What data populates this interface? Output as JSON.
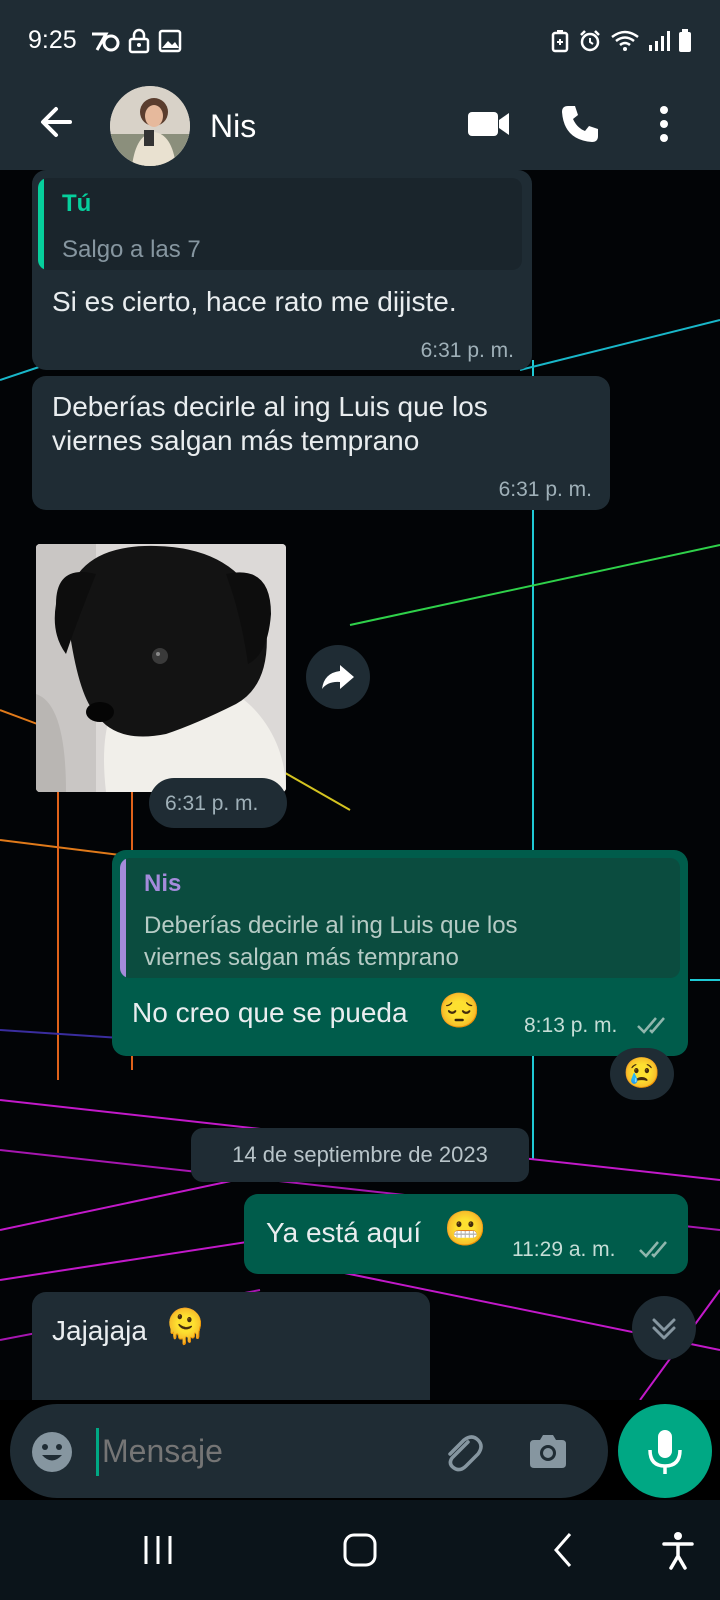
{
  "status_bar": {
    "time": "9:25",
    "left_icons": [
      "notification-icon",
      "lock-icon",
      "image-icon"
    ],
    "right_icons": [
      "battery-saver-icon",
      "alarm-icon",
      "wifi-icon",
      "signal-icon",
      "battery-icon"
    ]
  },
  "header": {
    "contact_name": "Nis",
    "back_icon": "arrow-left-icon",
    "video_icon": "video-camera-icon",
    "call_icon": "phone-icon",
    "menu_icon": "more-vert-icon"
  },
  "messages": [
    {
      "type": "incoming",
      "quote_author": "Tú",
      "quote_text": "Salgo a las 7",
      "text": "Si es cierto, hace rato me dijiste.",
      "time": "6:31 p. m."
    },
    {
      "type": "incoming",
      "text_line1": "Deberías decirle al ing Luis que los",
      "text_line2": "viernes salgan más temprano",
      "time": "6:31 p. m."
    },
    {
      "type": "incoming_image",
      "time": "6:31 p. m.",
      "forward_icon": "forward-icon"
    },
    {
      "type": "outgoing",
      "quote_author": "Nis",
      "quote_line1": "Deberías decirle al ing Luis que los",
      "quote_line2": "viernes salgan más temprano",
      "text": "No creo que se pueda",
      "emoji": "😔",
      "time": "8:13 p. m.",
      "reaction": "😢"
    },
    {
      "type": "date",
      "text": "14 de septiembre de 2023"
    },
    {
      "type": "outgoing",
      "text": "Ya está aquí",
      "emoji": "😬",
      "time": "11:29 a. m."
    },
    {
      "type": "incoming",
      "text": "Jajajaja",
      "emoji": "🫠"
    }
  ],
  "scroll_down_icon": "double-chevron-down-icon",
  "composer": {
    "placeholder": "Mensaje",
    "emoji_icon": "emoji-icon",
    "attach_icon": "paperclip-icon",
    "camera_icon": "camera-icon",
    "mic_icon": "microphone-icon"
  },
  "nav": [
    "recent-apps-icon",
    "home-icon",
    "back-icon",
    "accessibility-icon"
  ],
  "colors": {
    "header_bg": "#1f2c34",
    "incoming_bubble": "#1f2c34",
    "outgoing_bubble": "#005c4b",
    "accent": "#00a884",
    "quote_self": "#06cf9c",
    "quote_contact": "#a48bdb"
  }
}
